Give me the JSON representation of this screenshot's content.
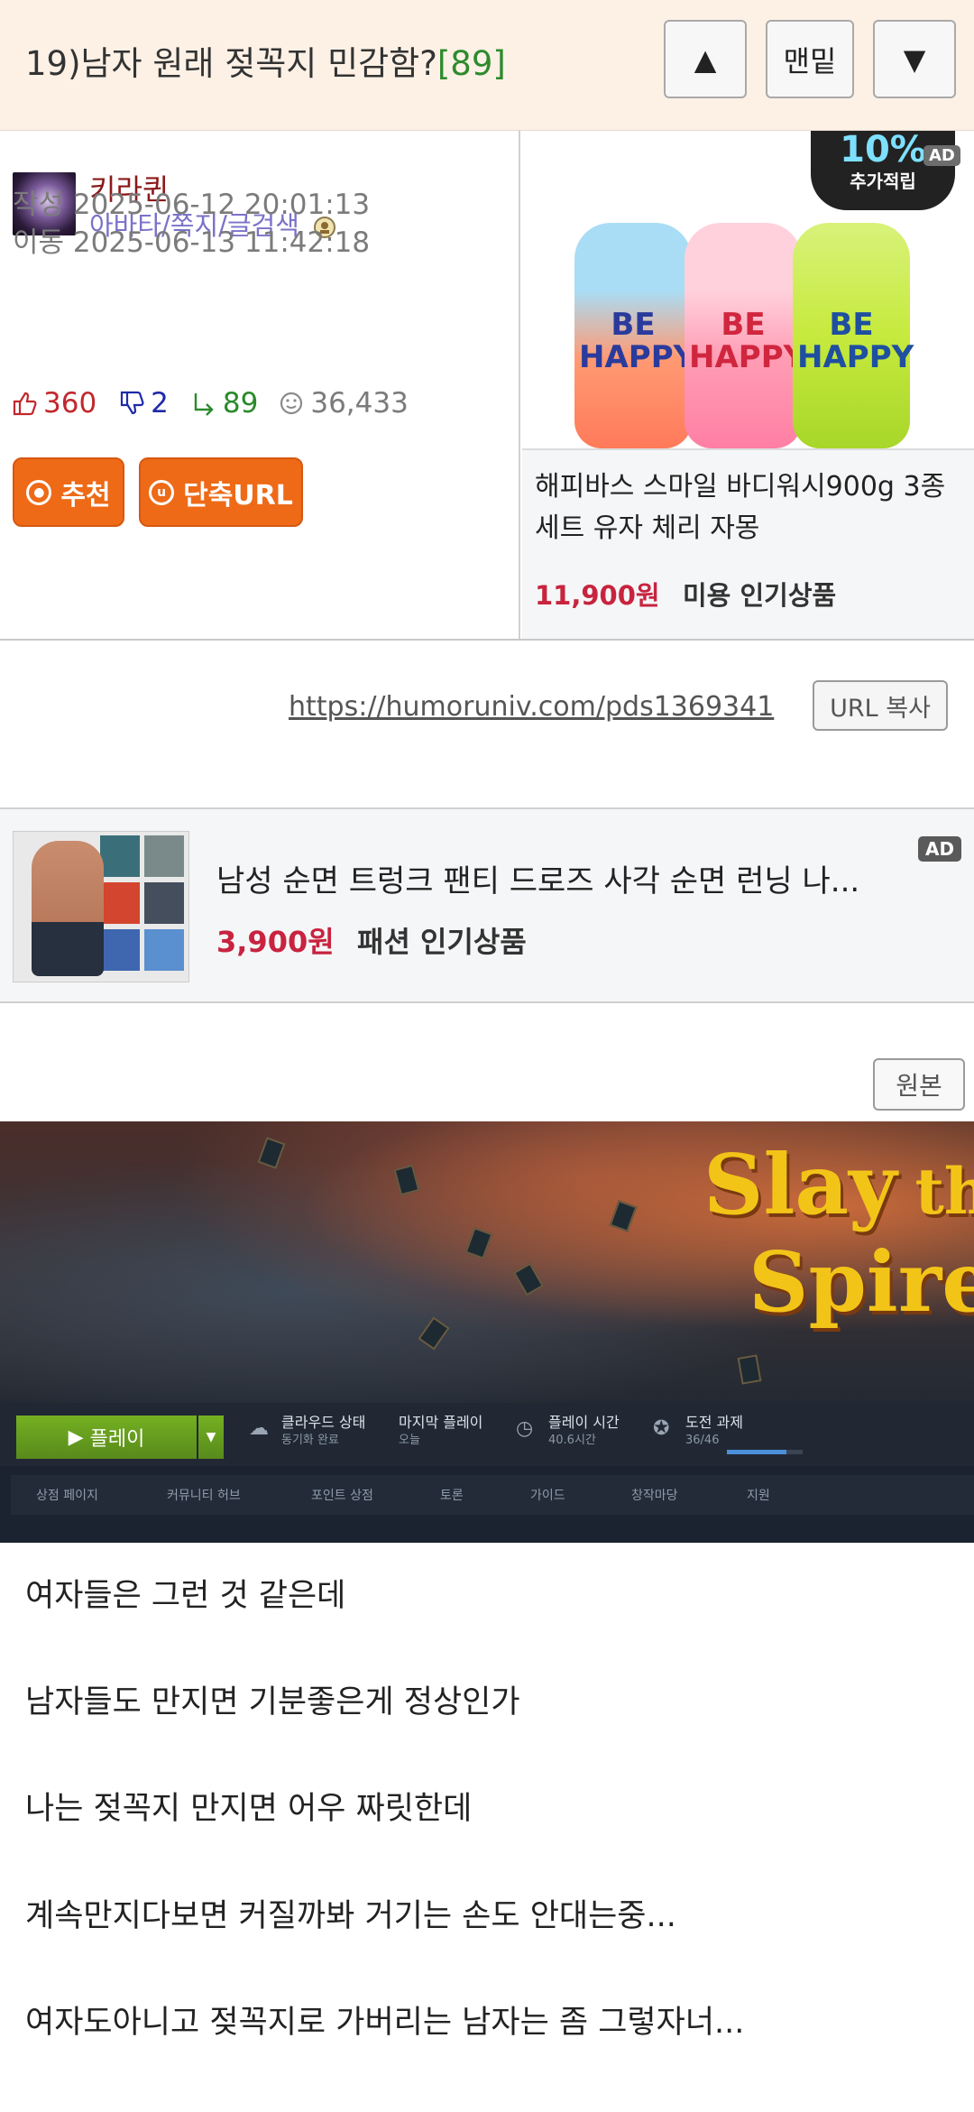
{
  "header": {
    "title": "19)남자 원래 젖꼭지 민감함?",
    "comment_count": "[89]",
    "up_icon": "▲",
    "bottom_label": "맨밑",
    "down_icon": "▼"
  },
  "post_info": {
    "username": "키라퀸",
    "user_links": "아바타/쪽지/글검색",
    "created": "작성 2025-06-12 20:01:13",
    "moved": "이동 2025-06-13 11:42:18",
    "likes": "360",
    "dislikes": "2",
    "replies": "89",
    "views": "36,433",
    "recommend_label": "추천",
    "short_url_label": "단축URL"
  },
  "ad_right": {
    "image_text": "BE HAPPY",
    "badge_percent": "10%",
    "badge_label": "추가적립",
    "ad_tag": "AD",
    "title": "해피바스 스마일 바디워시900g 3종 세트 유자 체리 자몽",
    "price": "11,900원",
    "category": "미용 인기상품"
  },
  "url": {
    "link": "https://humoruniv.com/pds1369341",
    "copy_label": "URL 복사"
  },
  "ad_banner": {
    "title": "남성 순면 트렁크 팬티 드로즈 사각 순면 런닝 나...",
    "price": "3,900원",
    "category": "패션 인기상품",
    "ad_tag": "AD"
  },
  "original_label": "원본",
  "screenshot": {
    "game_title_1": "Slay",
    "game_title_the": "the",
    "game_title_2": "Spire",
    "play_label": "플레이",
    "cloud_label": "클라우드 상태",
    "cloud_sub": "동기화 완료",
    "lastplay_label": "마지막 플레이",
    "lastplay_sub": "오늘",
    "playtime_label": "플레이 시간",
    "playtime_sub": "40.6시간",
    "achieve_label": "도전 과제",
    "achieve_sub": "36/46",
    "achieve_fraction": 0.78,
    "nav": [
      "상점 페이지",
      "커뮤니티 허브",
      "포인트 상점",
      "토론",
      "가이드",
      "창작마당",
      "지원"
    ]
  },
  "body": [
    "여자들은 그런 것 같은데",
    "남자들도 만지면 기분좋은게 정상인가",
    "나는 젖꼭지 만지면 어우 짜릿한데",
    "계속만지다보면 커질까봐 거기는 손도 안대는중...",
    "여자도아니고 젖꼭지로 가버리는 남자는 좀 그렇자너..."
  ]
}
